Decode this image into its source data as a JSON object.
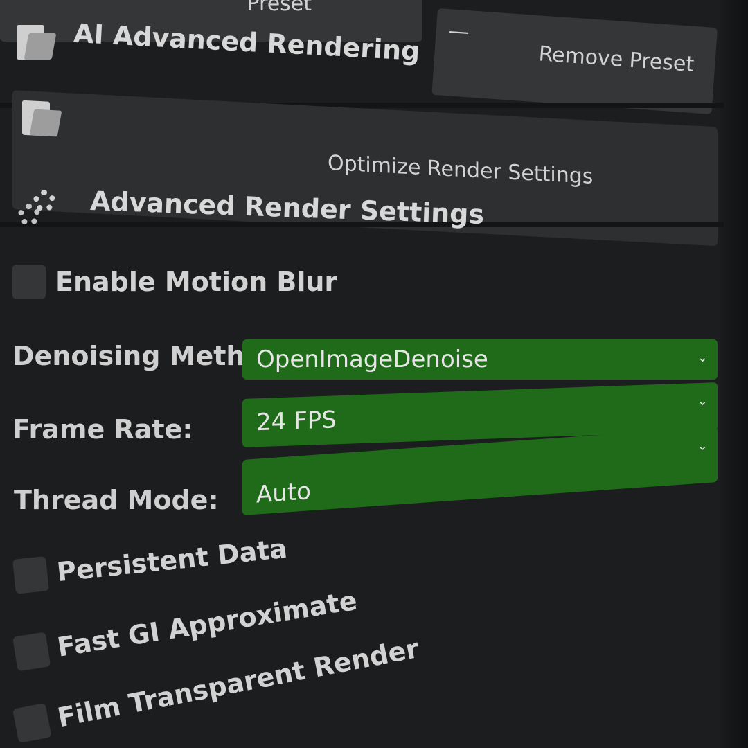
{
  "top_buttons": {
    "preset_label_partial": "Preset",
    "remove_icon": "minus-icon",
    "remove_label": "Remove Preset"
  },
  "ai_section": {
    "icon": "folder-icon",
    "title": "AI Advanced Rendering",
    "optimize_icon": "folder-icon",
    "optimize_label": "Optimize Render Settings"
  },
  "advanced_section": {
    "icon": "gear-icon",
    "title": "Advanced Render Settings"
  },
  "settings": {
    "motion_blur": {
      "label": "Enable Motion Blur",
      "checked": false
    },
    "denoising": {
      "label": "Denoising Method:",
      "value": "OpenImageDenoise"
    },
    "frame_rate": {
      "label": "Frame Rate:",
      "value": "24 FPS"
    },
    "thread_mode": {
      "label": "Thread Mode:",
      "value": "Auto"
    },
    "persistent_data": {
      "label": "Persistent Data",
      "checked": false
    },
    "fast_gi": {
      "label": "Fast GI Approximate",
      "checked": false
    },
    "film_transparent": {
      "label": "Film Transparent Render",
      "checked": false
    }
  },
  "colors": {
    "panel_bg": "#1c1d1e",
    "button_bg": "#353637",
    "select_accent": "#1f6b1a",
    "text": "#d9d9d9"
  }
}
